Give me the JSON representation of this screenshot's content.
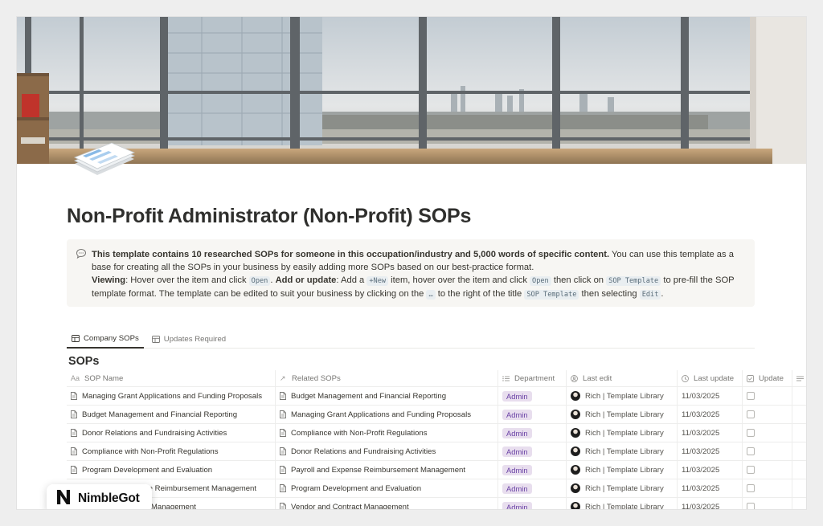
{
  "page": {
    "title": "Non-Profit Administrator (Non-Profit) SOPs",
    "cover_icon": "stacked-documents-icon"
  },
  "callout": {
    "icon": "speech-bubble-icon",
    "intro_bold": "This template contains 10 researched SOPs for someone in this occupation/industry and 5,000 words of specific content.",
    "intro_rest": " You can use this template as a base for creating all the SOPs in your business by easily adding more SOPs based on our best-practice format.",
    "viewing_label": "Viewing",
    "viewing_text_1": ": Hover over the item and click ",
    "open_code": "Open",
    "viewing_text_2": ". ",
    "add_label": "Add or update",
    "add_text_1": ": Add a ",
    "new_code": "+New",
    "add_text_2": " item, hover over the item and click ",
    "add_text_3": " then click on ",
    "sop_template_code": "SOP Template",
    "add_text_4": " to pre-fill the SOP template format. The template can be edited to suit your business by clicking on the ",
    "dots_code": "…",
    "add_text_5": " to the right of the title ",
    "add_text_6": " then selecting ",
    "edit_code": "Edit",
    "add_text_7": "."
  },
  "tabs": [
    {
      "label": "Company SOPs",
      "icon": "table-icon",
      "active": true
    },
    {
      "label": "Updates Required",
      "icon": "table-icon",
      "active": false
    }
  ],
  "database": {
    "title": "SOPs",
    "columns": {
      "name": "SOP Name",
      "related": "Related SOPs",
      "department": "Department",
      "last_edit": "Last edit",
      "last_update": "Last update",
      "update": "Update"
    },
    "column_icons": {
      "name": "Aa",
      "related": "↗",
      "department": "list-icon",
      "last_edit": "person-icon",
      "last_update": "clock-icon",
      "update": "checkbox-icon"
    },
    "rows": [
      {
        "name": "Managing Grant Applications and Funding Proposals",
        "related": "Budget Management and Financial Reporting",
        "department": "Admin",
        "editor": "Rich | Template Library",
        "date": "11/03/2025"
      },
      {
        "name": "Budget Management and Financial Reporting",
        "related": "Managing Grant Applications and Funding Proposals",
        "department": "Admin",
        "editor": "Rich | Template Library",
        "date": "11/03/2025"
      },
      {
        "name": "Donor Relations and Fundraising Activities",
        "related": "Compliance with Non-Profit Regulations",
        "department": "Admin",
        "editor": "Rich | Template Library",
        "date": "11/03/2025"
      },
      {
        "name": "Compliance with Non-Profit Regulations",
        "related": "Donor Relations and Fundraising Activities",
        "department": "Admin",
        "editor": "Rich | Template Library",
        "date": "11/03/2025"
      },
      {
        "name": "Program Development and Evaluation",
        "related": "Payroll and Expense Reimbursement Management",
        "department": "Admin",
        "editor": "Rich | Template Library",
        "date": "11/03/2025"
      },
      {
        "name": "Payroll and Expense Reimbursement Management",
        "related": "Program Development and Evaluation",
        "department": "Admin",
        "editor": "Rich | Template Library",
        "date": "11/03/2025"
      },
      {
        "name": "Event Planning and Management",
        "related": "Vendor and Contract Management",
        "department": "Admin",
        "editor": "Rich | Template Library",
        "date": "11/03/2025"
      }
    ]
  },
  "watermark": {
    "text": "NimbleGot",
    "logo": "N"
  },
  "colors": {
    "tag_bg": "#e8deee",
    "tag_text": "#6940a5",
    "callout_bg": "#f7f6f3"
  }
}
